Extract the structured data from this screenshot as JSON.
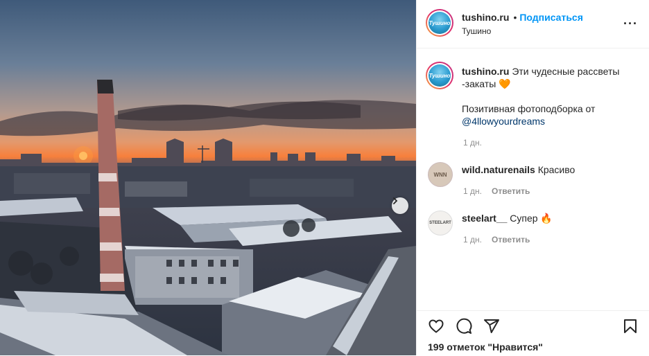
{
  "post": {
    "username": "tushino.ru",
    "dot": "•",
    "follow_label": "Подписаться",
    "location": "Тушино",
    "avatar_text": "Тушино",
    "more_icon": "more-dots-icon"
  },
  "caption": {
    "username": "tushino.ru",
    "text_line1": "Эти чудесные рассветы",
    "text_line2": "-закаты 🧡",
    "text_line3": "Позитивная фотоподборка от",
    "mention": "@4llowyourdreams",
    "time": "1 дн."
  },
  "comments": [
    {
      "username": "wild.naturenails",
      "text": "Красиво",
      "time": "1 дн.",
      "reply_label": "Ответить",
      "avatar_text": "WNN"
    },
    {
      "username": "steelart__",
      "text": "Супер 🔥",
      "time": "1 дн.",
      "reply_label": "Ответить",
      "avatar_text": "STEELART"
    }
  ],
  "actions": {
    "likes": "199 отметок \"Нравится\""
  },
  "colors": {
    "accent": "#0095f6",
    "mention": "#00376b",
    "muted": "#8e8e8e"
  }
}
